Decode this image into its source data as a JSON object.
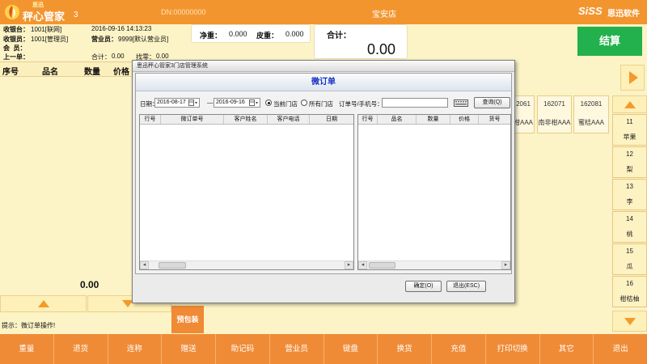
{
  "app": {
    "logo_brand": "思迅",
    "title": "秤心管家",
    "version": "3",
    "device_no": "DN:00000000",
    "store_name": "宝安店",
    "vendor_logo": "SiSS",
    "vendor_name": "思迅软件"
  },
  "info": {
    "register_label": "收银台：",
    "register_value": "1001[联网]",
    "datetime": "2016-09-16 14:13:23",
    "cashier_label": "收银员：",
    "cashier_value": "1001[管理员]",
    "salesperson_label": "营业员：",
    "salesperson_value": "9999[默认营业员]",
    "member_label": "会  员：",
    "last_order_label": "上一单：",
    "last_total_label": "合计：",
    "last_total_value": "0.00",
    "change_label": "找零：",
    "change_value": "0.00"
  },
  "scale": {
    "net_label": "净重：",
    "net_value": "0.000",
    "tare_label": "皮重：",
    "tare_value": "0.000"
  },
  "total": {
    "label": "合计：",
    "value": "0.00"
  },
  "settle_button": "结算",
  "order_list": {
    "headers": [
      "序号",
      "品名",
      "数量",
      "价格"
    ],
    "amount": "0.00"
  },
  "hint": "提示：微订单操作!",
  "prepack_button": "预包装",
  "products": [
    {
      "code": "2061",
      "name": "柑AAA"
    },
    {
      "code": "162071",
      "name": "南非柑AAA"
    },
    {
      "code": "162081",
      "name": "蜜桔AAA"
    }
  ],
  "categories": [
    {
      "code": "11",
      "name": "苹果"
    },
    {
      "code": "12",
      "name": "梨"
    },
    {
      "code": "13",
      "name": "李"
    },
    {
      "code": "14",
      "name": "桃"
    },
    {
      "code": "15",
      "name": "瓜"
    },
    {
      "code": "16",
      "name": "柑桔柚"
    }
  ],
  "function_keys": [
    "重量",
    "退货",
    "连称",
    "赠送",
    "助记码",
    "营业员",
    "键盘",
    "换货",
    "充值",
    "打印切换",
    "其它",
    "退出"
  ],
  "dialog": {
    "window_title": "思迅秤心管家3门店管理系统",
    "heading": "微订单",
    "date_label": "日期：",
    "date_from": "2016-08-17",
    "date_sep": "—",
    "date_to": "2016-09-16",
    "store_scope": {
      "options": [
        "当前门店",
        "所有门店"
      ],
      "selected": "当前门店"
    },
    "order_search_label": "订单号/手机号：",
    "order_search_value": "",
    "query_button": "查询(Q)",
    "orders_table": {
      "headers": [
        "行号",
        "微订单号",
        "客户姓名",
        "客户电话",
        "日期"
      ],
      "rows": []
    },
    "items_table": {
      "headers": [
        "行号",
        "品名",
        "数量",
        "价格",
        "货号"
      ],
      "rows": []
    },
    "ok_button": "确定(O)",
    "exit_button": "退出(ESC)"
  },
  "icons": {
    "logo": "logo-icon",
    "product_next": "right-arrow-icon",
    "list_up": "up-arrow-icon",
    "list_down": "down-arrow-icon",
    "date_picker": "calendar-icon",
    "keyboard": "keyboard-icon",
    "scroll_left": "scroll-left-icon",
    "scroll_right": "scroll-right-icon"
  },
  "colors": {
    "top_bar": "#f3952f",
    "bottom_bar": "#ef8b36",
    "settle_button": "#22b14c",
    "accent_orange": "#f08a34",
    "dialog_heading": "#1430c8",
    "page_background": "#fcf3c6"
  }
}
